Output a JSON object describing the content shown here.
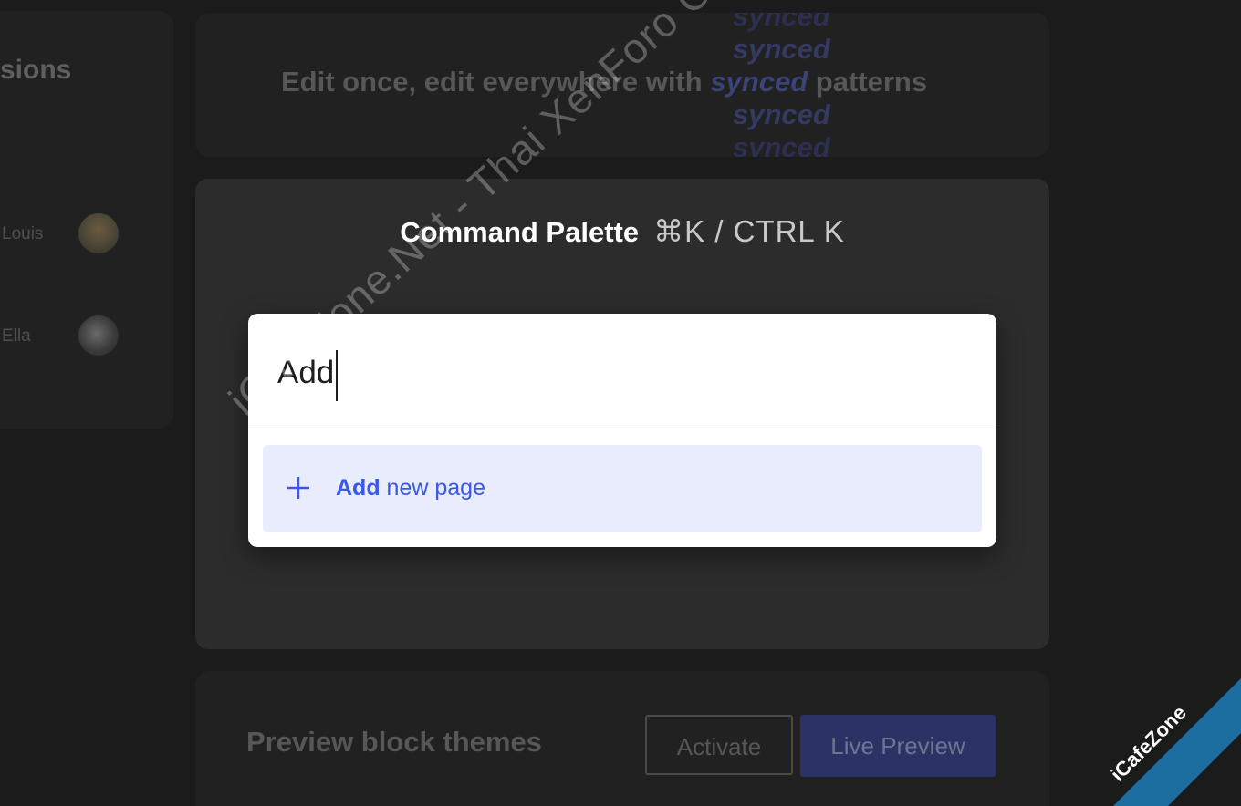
{
  "left_card": {
    "title": "sions",
    "users": [
      {
        "name": "Louis"
      },
      {
        "name": "Ella"
      }
    ]
  },
  "synced_card": {
    "text_before": "Edit once, edit everywhere with ",
    "highlight": "synced",
    "text_after": " patterns",
    "ghost_word": "synced"
  },
  "command_palette": {
    "title": "Command Palette",
    "shortcut": "⌘K / CTRL K",
    "input": {
      "value": "Add"
    },
    "results": [
      {
        "bold": "Add",
        "rest": " new page",
        "icon": "plus-icon"
      }
    ]
  },
  "theme_card": {
    "title": "Preview block themes",
    "activate_label": "Activate",
    "live_preview_label": "Live Preview"
  },
  "watermark": {
    "text": "iCafeZone.Net - Thai XenForo Community",
    "corner_text": "iCafeZone"
  },
  "colors": {
    "accent": "#3858e9",
    "result_bg": "#e9ecfc",
    "palette_bg": "#ffffff",
    "card_bg": "#2c2c2c"
  }
}
